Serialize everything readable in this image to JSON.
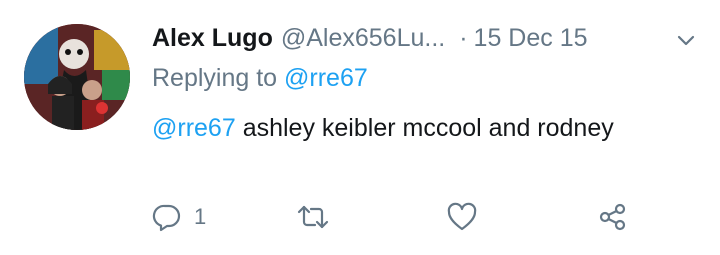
{
  "tweet": {
    "author_name": "Alex Lugo",
    "author_handle": "@Alex656Lu...",
    "separator": "·",
    "date": "15 Dec 15",
    "replying_prefix": "Replying to",
    "replying_handle": "@rre67",
    "body_mention": "@rre67",
    "body_text": " ashley keibler mccool and rodney"
  },
  "actions": {
    "reply_icon": "reply-icon",
    "reply_count": "1",
    "retweet_icon": "retweet-icon",
    "like_icon": "heart-icon",
    "share_icon": "share-icon"
  },
  "colors": {
    "text": "#14171a",
    "secondary": "#657786",
    "link": "#1da1f2",
    "background": "#ffffff"
  }
}
